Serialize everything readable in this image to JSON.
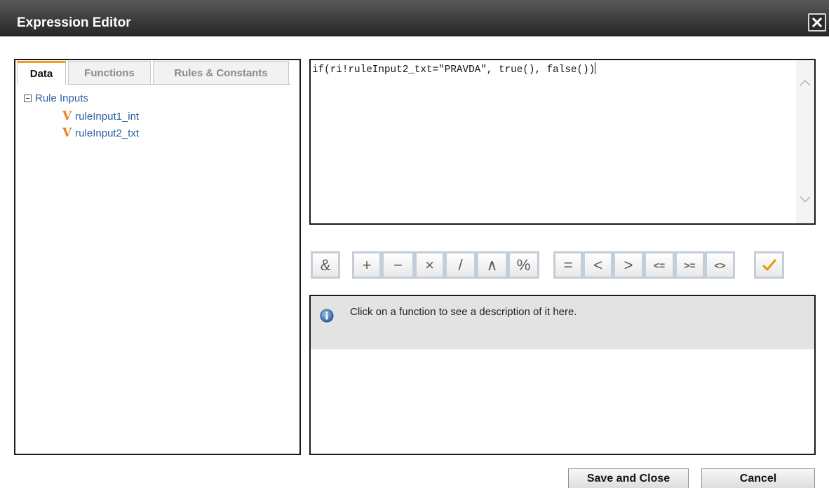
{
  "window": {
    "title": "Expression Editor",
    "close_icon": "close-icon"
  },
  "left_panel": {
    "tabs": [
      {
        "label": "Data",
        "active": true
      },
      {
        "label": "Functions",
        "active": false
      },
      {
        "label": "Rules & Constants",
        "active": false
      }
    ],
    "tree": {
      "root_label": "Rule Inputs",
      "expanded": true,
      "items": [
        {
          "icon": "V",
          "label": "ruleInput1_int"
        },
        {
          "icon": "V",
          "label": "ruleInput2_txt"
        }
      ]
    }
  },
  "editor": {
    "expression": "if(ri!ruleInput2_txt=\"PRAVDA\", true(), false())"
  },
  "toolbar": {
    "operators": [
      "&",
      "+",
      "−",
      "×",
      "/",
      "∧",
      "%",
      "=",
      "<",
      ">",
      "<=",
      ">=",
      "<>"
    ],
    "validate_icon": "checkmark-icon"
  },
  "description": {
    "icon": "info-icon",
    "text": "Click on a function to see a description of it here."
  },
  "footer": {
    "save_label": "Save and Close",
    "cancel_label": "Cancel"
  },
  "colors": {
    "accent": "#f19c24",
    "link": "#2e5fa3",
    "titlebar": "#3c3c3c",
    "variable_icon": "#e8841c"
  }
}
